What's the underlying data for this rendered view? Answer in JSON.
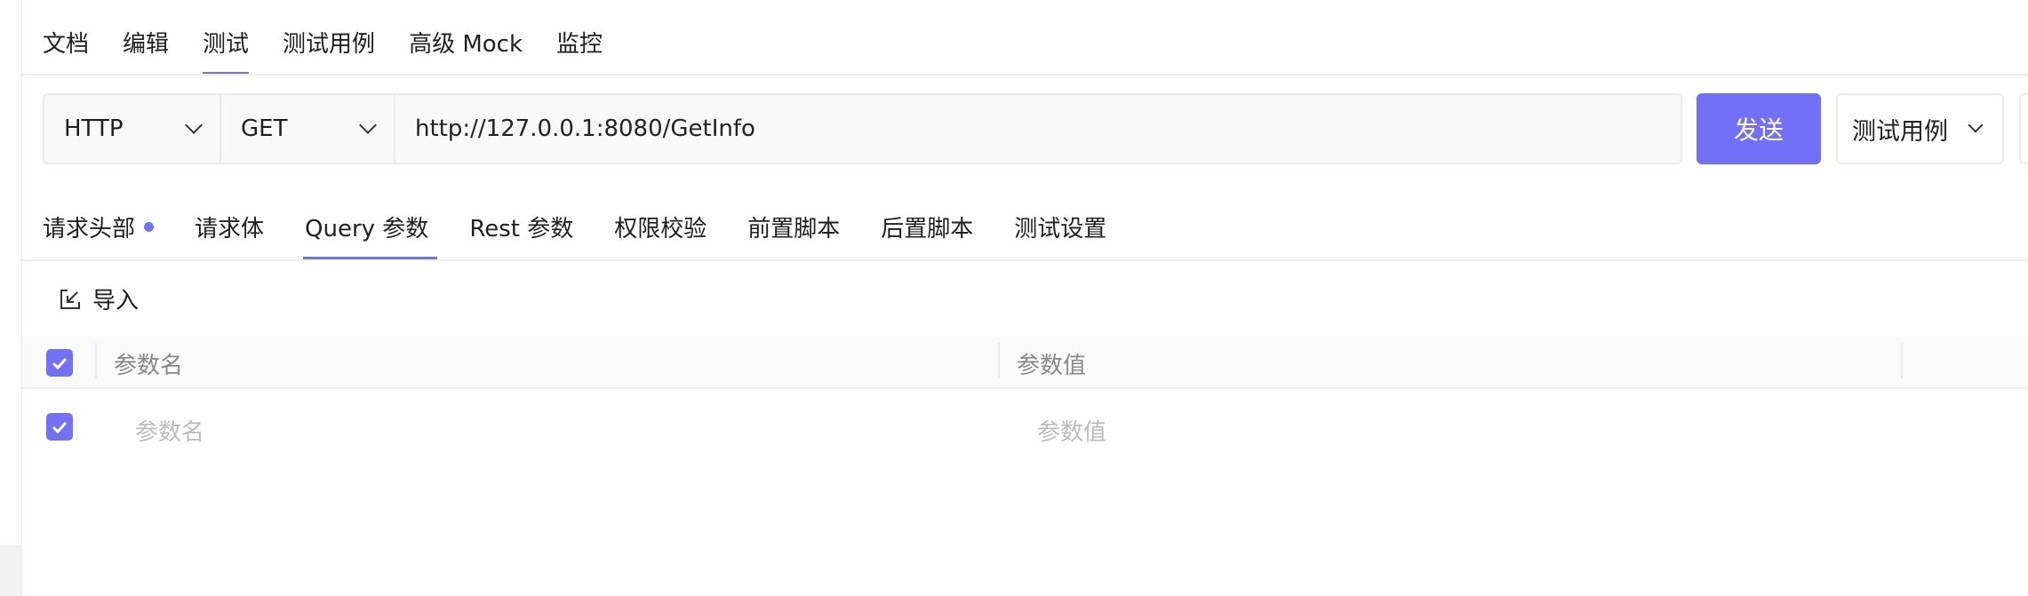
{
  "top_tabs": [
    {
      "label": "文档"
    },
    {
      "label": "编辑"
    },
    {
      "label": "测试",
      "active": true
    },
    {
      "label": "测试用例"
    },
    {
      "label": "高级 Mock"
    },
    {
      "label": "监控"
    }
  ],
  "request": {
    "protocol": "HTTP",
    "method": "GET",
    "url": "http://127.0.0.1:8080/GetInfo",
    "send_label": "发送",
    "cases_label": "测试用例"
  },
  "sub_tabs": [
    {
      "label": "请求头部",
      "dot": true
    },
    {
      "label": "请求体"
    },
    {
      "label": "Query 参数",
      "active": true
    },
    {
      "label": "Rest 参数"
    },
    {
      "label": "权限校验"
    },
    {
      "label": "前置脚本"
    },
    {
      "label": "后置脚本"
    },
    {
      "label": "测试设置"
    }
  ],
  "import_label": "导入",
  "table": {
    "headers": [
      "参数名",
      "参数值"
    ],
    "row": {
      "checked": true,
      "name_placeholder": "参数名",
      "value_placeholder": "参数值"
    },
    "header_checked": true
  },
  "colors": {
    "accent": "#7270f7"
  }
}
